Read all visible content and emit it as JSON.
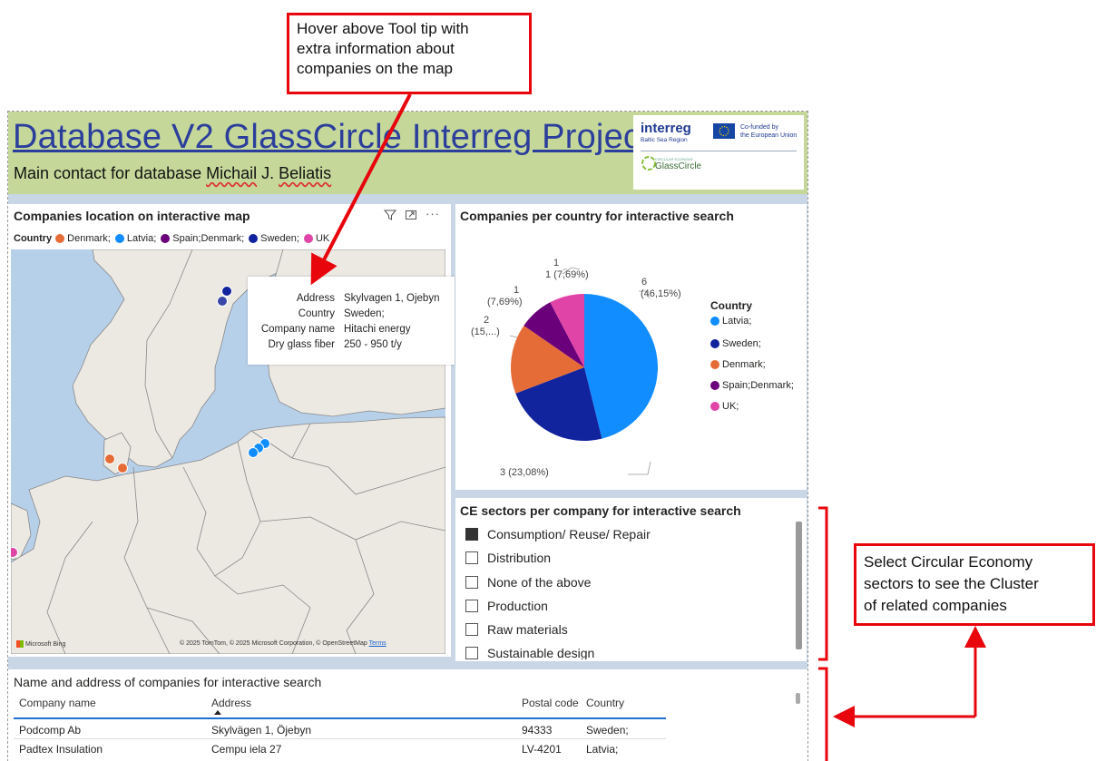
{
  "callouts": {
    "top": [
      "Hover above Tool tip with",
      "extra information about",
      "companies on the map"
    ],
    "right": [
      "Select Circular Economy",
      "sectors to see the Cluster",
      "of related companies"
    ]
  },
  "header": {
    "title": "Database V2 GlassCircle Interreg Project",
    "subtitle_prefix": "Main contact for database ",
    "subtitle_first": "Michail",
    "subtitle_mid": " J. ",
    "subtitle_last": "Beliatis"
  },
  "logo": {
    "brand": "interreg",
    "region": "Baltic Sea Region",
    "cofund_1": "Co-funded by",
    "cofund_2": "the European Union",
    "tag": "CIRCULAR ECONOMY",
    "project": "GlassCircle"
  },
  "map": {
    "title": "Companies location on interactive map",
    "legend_label": "Country",
    "legend": [
      {
        "name": "Denmark;",
        "color": "#e66c37"
      },
      {
        "name": "Latvia;",
        "color": "#118dff"
      },
      {
        "name": "Spain;Denmark;",
        "color": "#6b007b"
      },
      {
        "name": "Sweden;",
        "color": "#12239e"
      },
      {
        "name": "UK",
        "color": "#e044a7"
      }
    ],
    "attribution_bing": "Microsoft Bing",
    "attribution": "© 2025 TomTom, © 2025 Microsoft Corporation, © OpenStreetMap",
    "terms": "Terms",
    "icons": [
      "filter-icon",
      "focus-mode-icon",
      "more-options-icon"
    ]
  },
  "tooltip": {
    "rows": [
      {
        "key": "Address",
        "value": "Skylvagen 1, Ojebyn"
      },
      {
        "key": "Country",
        "value": "Sweden;"
      },
      {
        "key": "Company name",
        "value": "Hitachi energy"
      },
      {
        "key": "Dry glass fiber",
        "value": "250 - 950 t/y"
      }
    ]
  },
  "pie": {
    "title": "Companies per country for interactive search",
    "legend_title": "Country",
    "labels": {
      "latvia_1": "6",
      "latvia_2": "(46,15%)",
      "sweden": "3 (23,08%)",
      "denmark_1": "2",
      "denmark_2": "(15,...)",
      "spain_1": "1",
      "spain_2": "(7,69%)",
      "uk_1": "1",
      "uk_2": "1  (7,69%)"
    }
  },
  "chart_data": {
    "type": "pie",
    "title": "Companies per country for interactive search",
    "legend_title": "Country",
    "legend_position": "right",
    "slices": [
      {
        "name": "Latvia;",
        "value": 6,
        "percent": "46,15%",
        "color": "#118dff"
      },
      {
        "name": "Sweden;",
        "value": 3,
        "percent": "23,08%",
        "color": "#12239e"
      },
      {
        "name": "Denmark;",
        "value": 2,
        "percent": "15,...",
        "color": "#e66c37"
      },
      {
        "name": "Spain;Denmark;",
        "value": 1,
        "percent": "7,69%",
        "color": "#6b007b"
      },
      {
        "name": "UK;",
        "value": 1,
        "percent": "7,69%",
        "color": "#e044a7"
      }
    ]
  },
  "slicer": {
    "title": "CE sectors per company for interactive search",
    "items": [
      {
        "label": "Consumption/ Reuse/ Repair",
        "checked": true
      },
      {
        "label": "Distribution",
        "checked": false
      },
      {
        "label": "None of the above",
        "checked": false
      },
      {
        "label": "Production",
        "checked": false
      },
      {
        "label": "Raw materials",
        "checked": false
      },
      {
        "label": "Sustainable design",
        "checked": false
      }
    ]
  },
  "table": {
    "title": "Name and address of companies for interactive search",
    "columns": [
      "Company name",
      "Address",
      "Postal code",
      "Country"
    ],
    "rows": [
      [
        "Podcomp Ab",
        "Skylvägen 1, Öjebyn",
        "94333",
        "Sweden;"
      ],
      [
        "Padtex Insulation",
        "Cempu iela 27",
        "LV-4201",
        "Latvia;"
      ]
    ]
  }
}
